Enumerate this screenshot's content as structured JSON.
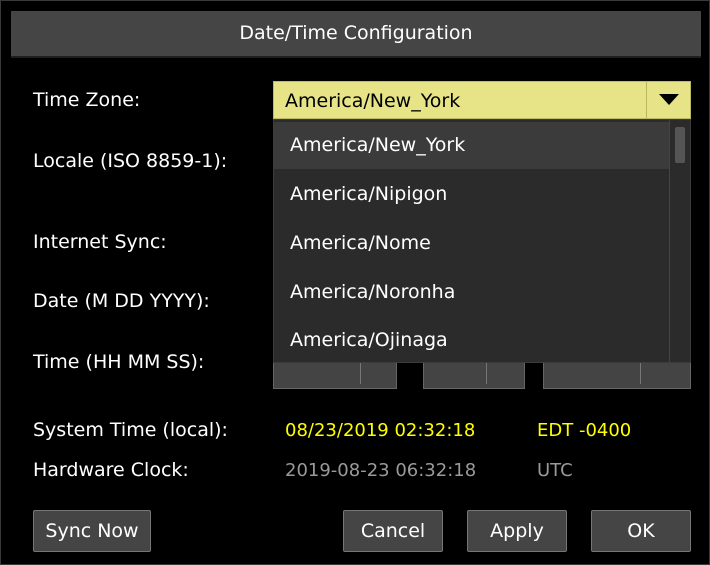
{
  "dialog": {
    "title": "Date/Time Configuration"
  },
  "labels": {
    "time_zone": "Time Zone:",
    "locale": "Locale (ISO 8859-1):",
    "internet_sync": "Internet Sync:",
    "date": "Date (M DD YYYY):",
    "time": "Time (HH MM SS):",
    "system_time": "System Time (local):",
    "hardware_clock": "Hardware Clock:"
  },
  "time_zone": {
    "selected": "America/New_York",
    "open": true,
    "options": [
      "America/New_York",
      "America/Nipigon",
      "America/Nome",
      "America/Noronha",
      "America/Ojinaga"
    ],
    "highlighted_index": 0
  },
  "system_time": {
    "value": "08/23/2019 02:32:18",
    "zone": "EDT -0400"
  },
  "hardware_clock": {
    "value": "2019-08-23 06:32:18",
    "zone": "UTC"
  },
  "buttons": {
    "sync_now": "Sync Now",
    "cancel": "Cancel",
    "apply": "Apply",
    "ok": "OK"
  },
  "colors": {
    "highlight_text": "#ffff00",
    "muted_text": "#9a9a9a",
    "combo_bg": "#e6e487",
    "title_bg": "#454545"
  },
  "icons": {
    "combo_arrow": "triangle-down"
  }
}
